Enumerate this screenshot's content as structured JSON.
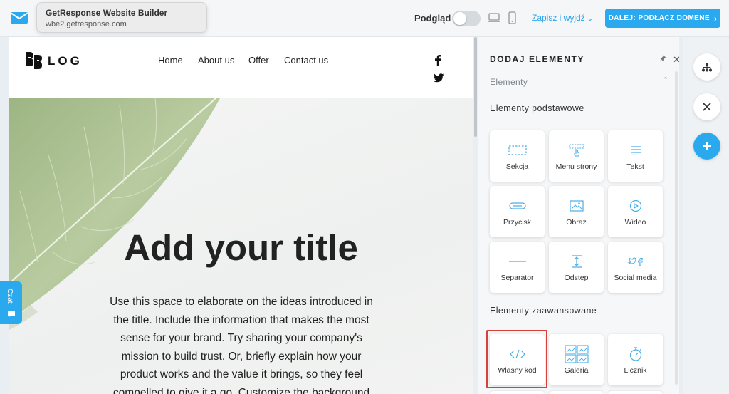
{
  "tooltip": {
    "title": "GetResponse Website Builder",
    "url": "wbe2.getresponse.com"
  },
  "toolbar": {
    "preview_label": "Podgląd",
    "save_exit_label": "Zapisz i wyjdź",
    "next_label": "DALEJ: PODŁĄCZ DOMENĘ"
  },
  "site": {
    "logo_text": "LOG",
    "nav": [
      "Home",
      "About us",
      "Offer",
      "Contact us"
    ],
    "title": "Add your title",
    "body": "Use this space to elaborate on the ideas introduced in the title. Include the information that makes the most sense for your brand. Try sharing your company's mission to build trust. Or, briefly explain how your product works and the value it brings, so they feel compelled to give it a go. Customize the background"
  },
  "chat": {
    "label": "Czat"
  },
  "panel": {
    "title": "DODAJ ELEMENTY",
    "section": "Elementy",
    "basic_title": "Elementy podstawowe",
    "basic": [
      {
        "label": "Sekcja",
        "icon": "section-icon"
      },
      {
        "label": "Menu strony",
        "icon": "menu-icon"
      },
      {
        "label": "Tekst",
        "icon": "text-icon"
      },
      {
        "label": "Przycisk",
        "icon": "button-icon"
      },
      {
        "label": "Obraz",
        "icon": "image-icon"
      },
      {
        "label": "Wideo",
        "icon": "video-icon"
      },
      {
        "label": "Separator",
        "icon": "separator-icon"
      },
      {
        "label": "Odstęp",
        "icon": "spacer-icon"
      },
      {
        "label": "Social media",
        "icon": "social-icon"
      }
    ],
    "advanced_title": "Elementy zaawansowane",
    "advanced": [
      {
        "label": "Własny kod",
        "icon": "code-icon"
      },
      {
        "label": "Galeria",
        "icon": "gallery-icon"
      },
      {
        "label": "Licznik",
        "icon": "timer-icon"
      }
    ]
  },
  "colors": {
    "accent": "#2aa9ee",
    "highlight": "#d8403a"
  }
}
